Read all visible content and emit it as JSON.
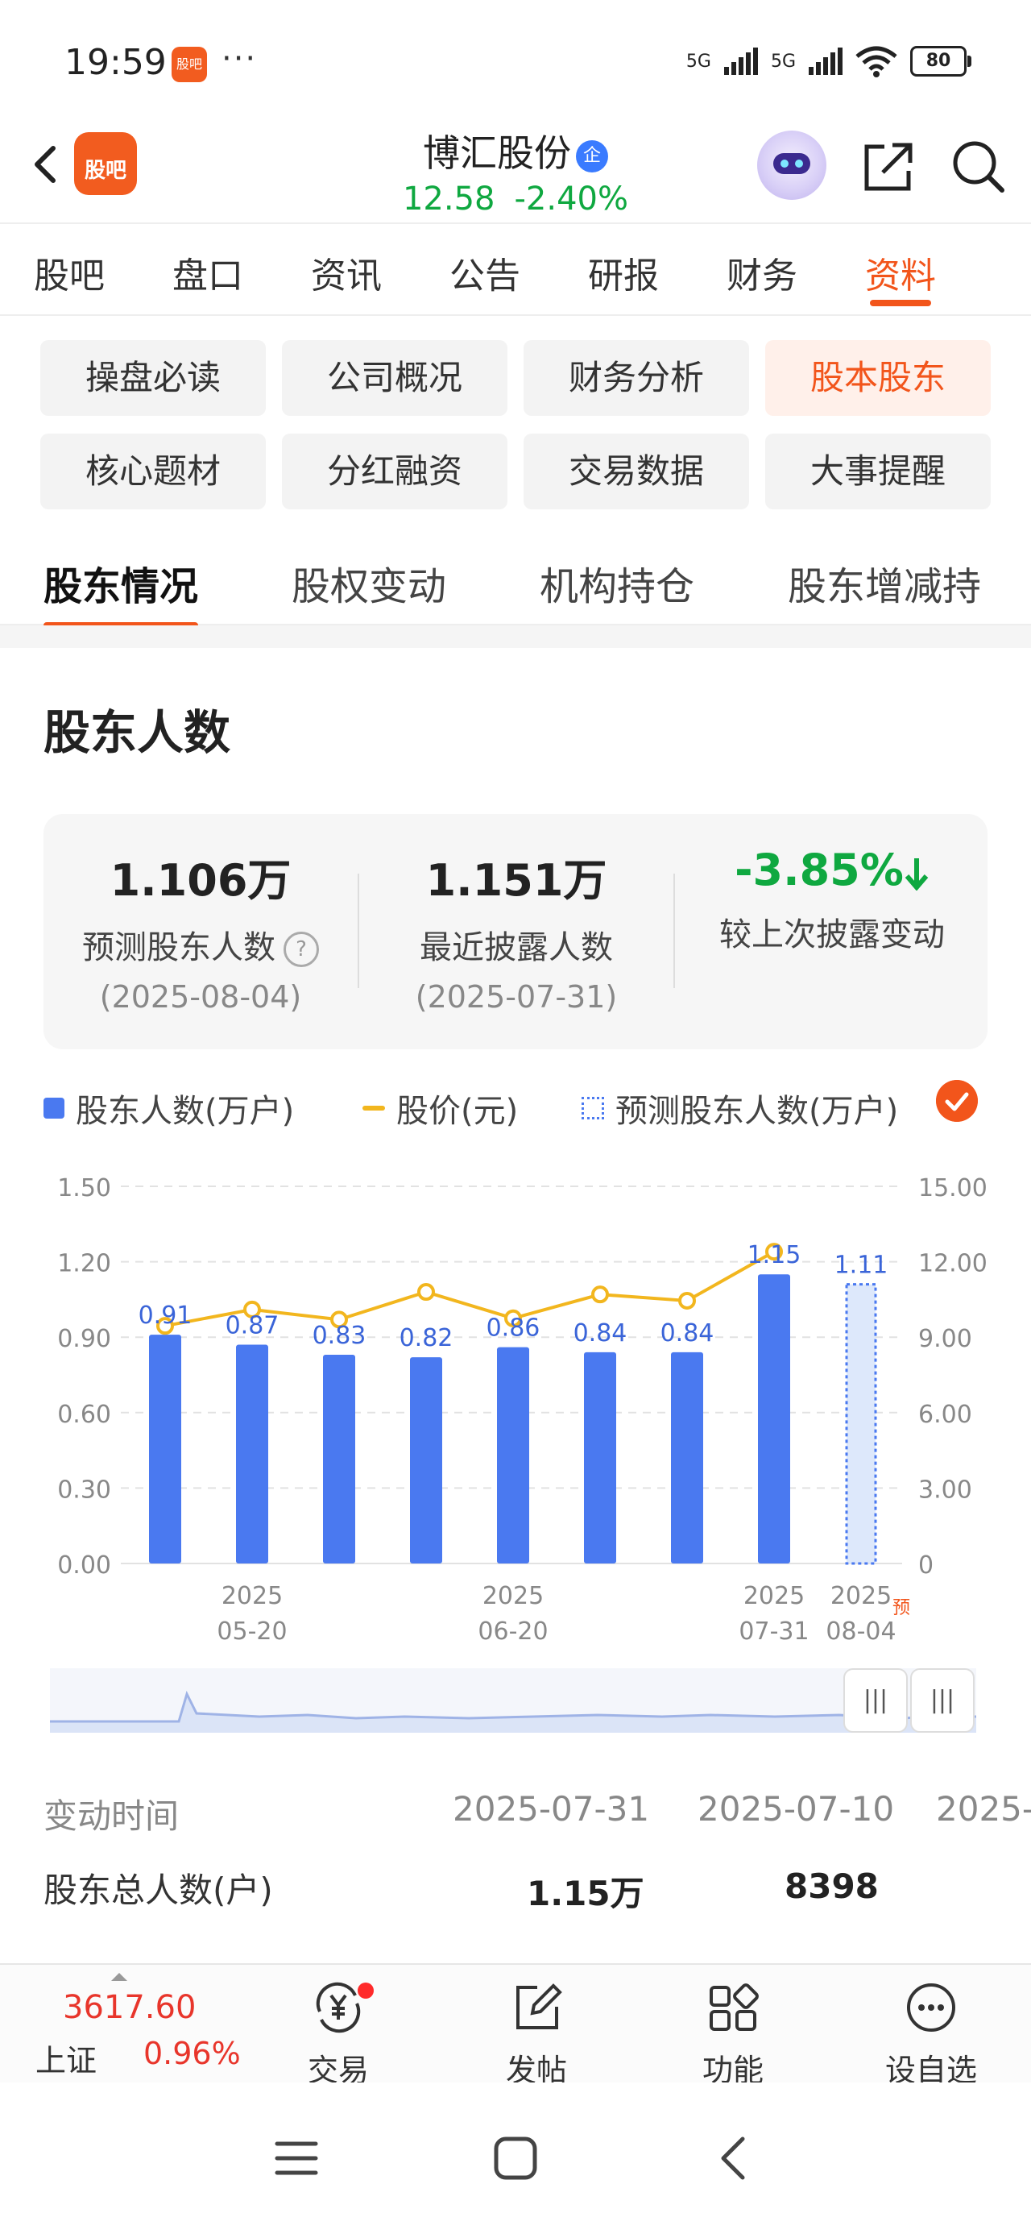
{
  "status_bar": {
    "time": "19:59",
    "app_icon_label": "股吧",
    "dots": "···",
    "network1": "5G",
    "network2": "5G",
    "battery": "80"
  },
  "header": {
    "logo_text": "股吧",
    "title": "博汇股份",
    "badge": "企",
    "price": "12.58",
    "change": "-2.40%"
  },
  "main_tabs": [
    {
      "label": "股吧"
    },
    {
      "label": "盘口"
    },
    {
      "label": "资讯"
    },
    {
      "label": "公告"
    },
    {
      "label": "研报"
    },
    {
      "label": "财务"
    },
    {
      "label": "资料",
      "active": true
    }
  ],
  "chips": [
    {
      "label": "操盘必读"
    },
    {
      "label": "公司概况"
    },
    {
      "label": "财务分析"
    },
    {
      "label": "股本股东",
      "active": true
    },
    {
      "label": "核心题材"
    },
    {
      "label": "分红融资"
    },
    {
      "label": "交易数据"
    },
    {
      "label": "大事提醒"
    }
  ],
  "sub_tabs": [
    {
      "label": "股东情况",
      "active": true
    },
    {
      "label": "股权变动"
    },
    {
      "label": "机构持仓"
    },
    {
      "label": "股东增减持"
    }
  ],
  "section": {
    "title": "股东人数"
  },
  "stats": [
    {
      "value": "1.106万",
      "label": "预测股东人数",
      "date": "(2025-08-04)",
      "help": "?"
    },
    {
      "value": "1.151万",
      "label": "最近披露人数",
      "date": "(2025-07-31)"
    },
    {
      "value": "-3.85%",
      "label": "较上次披露变动"
    }
  ],
  "legend": [
    {
      "label": "股东人数(万户)",
      "color": "#4a79f0"
    },
    {
      "label": "股价(元)",
      "color": "#f2b61e"
    },
    {
      "label": "预测股东人数(万户)",
      "color": "#4a79f0"
    }
  ],
  "chart_data": {
    "type": "bar",
    "bars": [
      0.91,
      0.87,
      0.83,
      0.82,
      0.86,
      0.84,
      0.84,
      1.15
    ],
    "bar_labels": [
      "0.91",
      "0.87",
      "0.83",
      "0.82",
      "0.86",
      "0.84",
      "0.84",
      "1.15"
    ],
    "forecast_bar": 1.11,
    "forecast_label": "1.11",
    "price_line": [
      9.45,
      10.1,
      9.7,
      10.8,
      9.75,
      10.7,
      10.45,
      12.4
    ],
    "y_left": {
      "min": 0,
      "max": 1.5,
      "ticks": [
        "0.00",
        "0.30",
        "0.60",
        "0.90",
        "1.20",
        "1.50"
      ]
    },
    "y_right": {
      "min": 0,
      "max": 15,
      "ticks": [
        "0",
        "3.00",
        "6.00",
        "9.00",
        "12.00",
        "15.00"
      ]
    },
    "x_labels": [
      {
        "index": 1,
        "year": "2025",
        "date": "05-20"
      },
      {
        "index": 4,
        "year": "2025",
        "date": "06-20"
      },
      {
        "index": 7,
        "year": "2025",
        "date": "07-31"
      },
      {
        "index": 8,
        "year": "2025",
        "date": "08-04"
      }
    ],
    "forecast_tag": "预",
    "grid": true,
    "bar_color": "#4a79f0",
    "line_color": "#f2b61e"
  },
  "table": {
    "header_label": "变动时间",
    "dates": [
      "2025-07-31",
      "2025-07-10",
      "2025-"
    ],
    "row_label": "股东总人数(户)",
    "values": [
      "1.15万",
      "8398"
    ]
  },
  "bottom_bar": {
    "index_value": "3617.60",
    "index_name": "上证",
    "index_change": "0.96%",
    "items": [
      {
        "label": "交易"
      },
      {
        "label": "发帖"
      },
      {
        "label": "功能"
      },
      {
        "label": "设自选"
      }
    ]
  }
}
